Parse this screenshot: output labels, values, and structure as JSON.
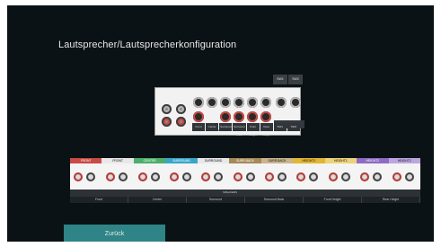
{
  "title": "Lautsprecher/Lautsprecherkonfiguration",
  "rear_panel": {
    "preout_tabs": [
      "SW1",
      "SW2"
    ],
    "pre_out_label": "PRE OUT",
    "channel_labels": [
      "Front",
      "Center",
      "Surround",
      "Surround Back",
      "Front Height",
      "Rear Height",
      "SW1",
      "SW2"
    ]
  },
  "terminal_bar": {
    "top_labels": [
      "FRONT",
      "FRONT",
      "CENTER",
      "SURROUND",
      "SURROUND",
      "SURR.BACK",
      "SURR.BACK",
      "HEIGHT1",
      "HEIGHT1",
      "HEIGHT2",
      "HEIGHT2"
    ],
    "speakers_label": "SPEAKERS",
    "bottom_labels": [
      "Front",
      "Center",
      "Surround",
      "Surround Back",
      "Front Height",
      "Rear Height"
    ]
  },
  "back_button": "Zurück",
  "colors": {
    "screen_bg": "#0b1216",
    "button_bg": "#2f8487",
    "front": "#c94b45",
    "center": "#4caf6b",
    "surround": "#39a6c9",
    "surround_back": "#a78a5a",
    "height1": "#e0b733",
    "height2": "#8f6cc4"
  }
}
